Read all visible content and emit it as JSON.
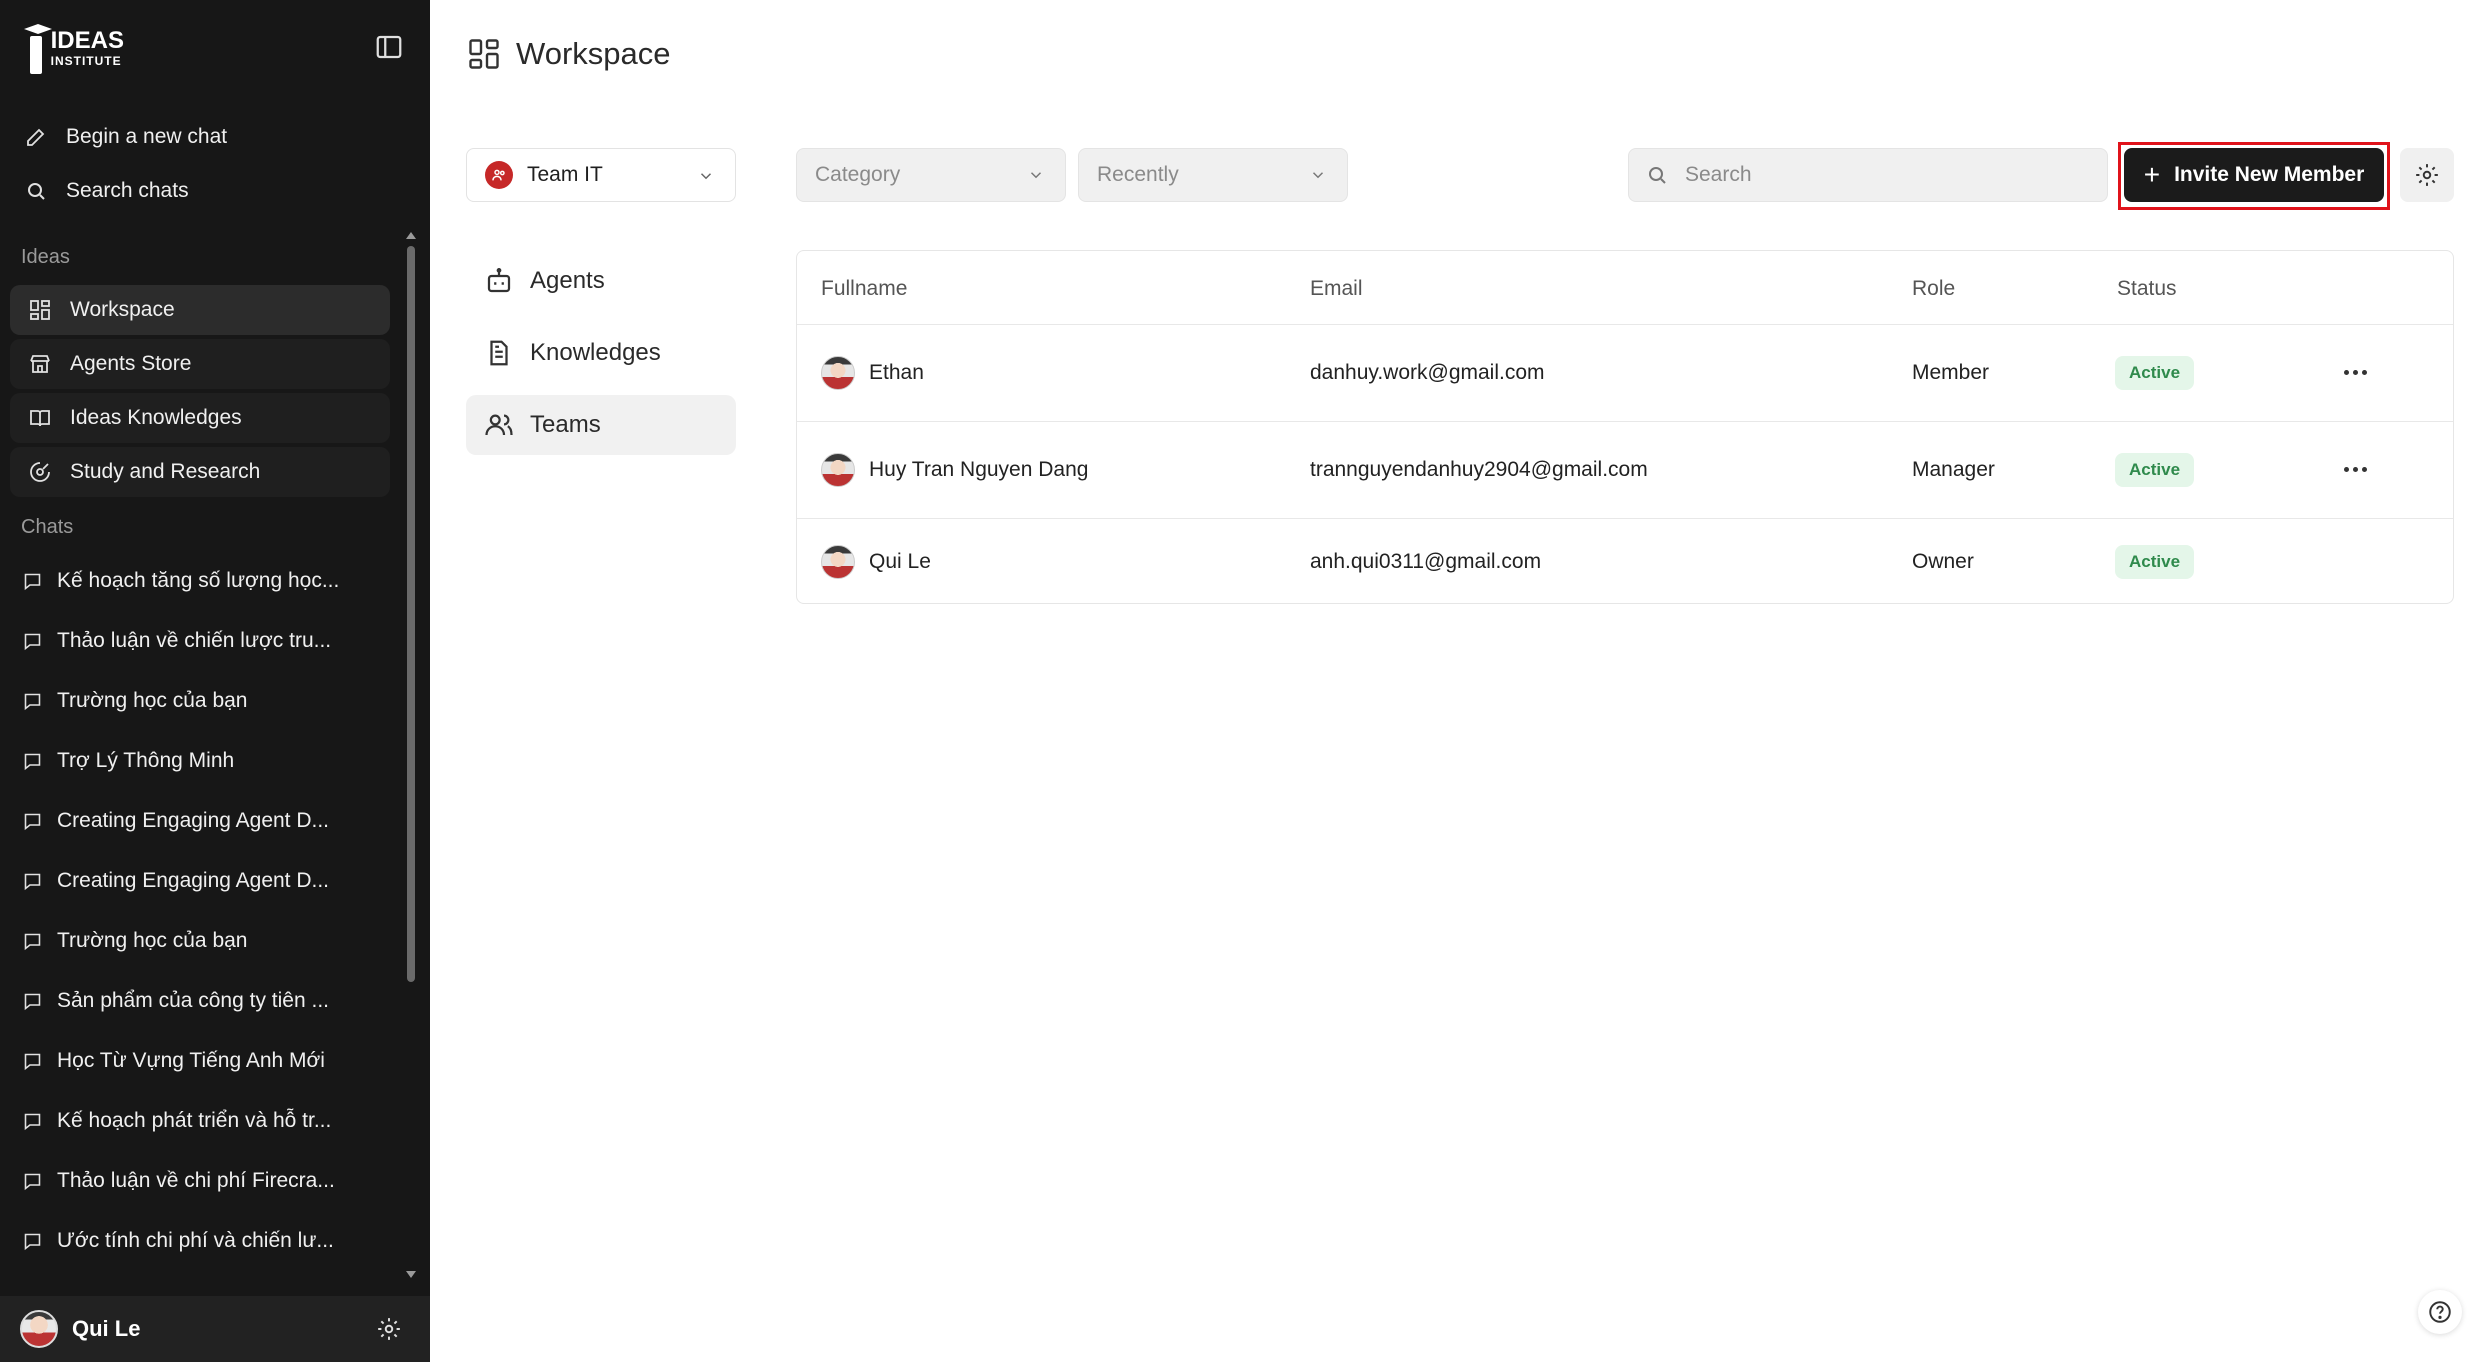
{
  "brand": {
    "logo_line1": "IDEAS",
    "logo_line2": "INSTITUTE"
  },
  "sidebar": {
    "new_chat": "Begin a new chat",
    "search_chats": "Search chats",
    "ideas_label": "Ideas",
    "nav": [
      {
        "label": "Workspace",
        "icon": "grid-icon",
        "active": true
      },
      {
        "label": "Agents Store",
        "icon": "store-icon"
      },
      {
        "label": "Ideas Knowledges",
        "icon": "book-icon"
      },
      {
        "label": "Study and Research",
        "icon": "research-icon"
      }
    ],
    "chats_label": "Chats",
    "chats": [
      "Kế hoạch tăng số lượng học...",
      "Thảo luận về chiến lược tru...",
      "Trường học của bạn",
      "Trợ Lý Thông Minh",
      "Creating Engaging Agent D...",
      "Creating Engaging Agent D...",
      "Trường học của bạn",
      "Sản phẩm của công ty tiên ...",
      "Học Từ Vựng Tiếng Anh Mới",
      "Kế hoạch phát triển và hỗ tr...",
      "Thảo luận về chi phí Firecra...",
      "Ước tính chi phí và chiến lư..."
    ],
    "user_name": "Qui Le"
  },
  "main": {
    "title": "Workspace",
    "team_select": "Team IT",
    "tabs": [
      {
        "label": "Agents",
        "icon": "robot-icon"
      },
      {
        "label": "Knowledges",
        "icon": "document-icon"
      },
      {
        "label": "Teams",
        "icon": "users-icon",
        "active": true
      }
    ],
    "filters": {
      "category": "Category",
      "sort": "Recently"
    },
    "search_placeholder": "Search",
    "invite_label": "Invite New Member",
    "table": {
      "headers": [
        "Fullname",
        "Email",
        "Role",
        "Status"
      ],
      "rows": [
        {
          "name": "Ethan",
          "email": "danhuy.work@gmail.com",
          "role": "Member",
          "status": "Active"
        },
        {
          "name": "Huy Tran Nguyen Dang",
          "email": "trannguyendanhuy2904@gmail.com",
          "role": "Manager",
          "status": "Active"
        },
        {
          "name": "Qui Le",
          "email": "anh.qui0311@gmail.com",
          "role": "Owner",
          "status": "Active"
        }
      ]
    }
  },
  "colors": {
    "sidebar_bg": "#171717",
    "accent_red": "#e0131b",
    "status_green": "#2f8a4c",
    "status_bg": "#e4f6e9",
    "team_dot": "#c62828"
  }
}
